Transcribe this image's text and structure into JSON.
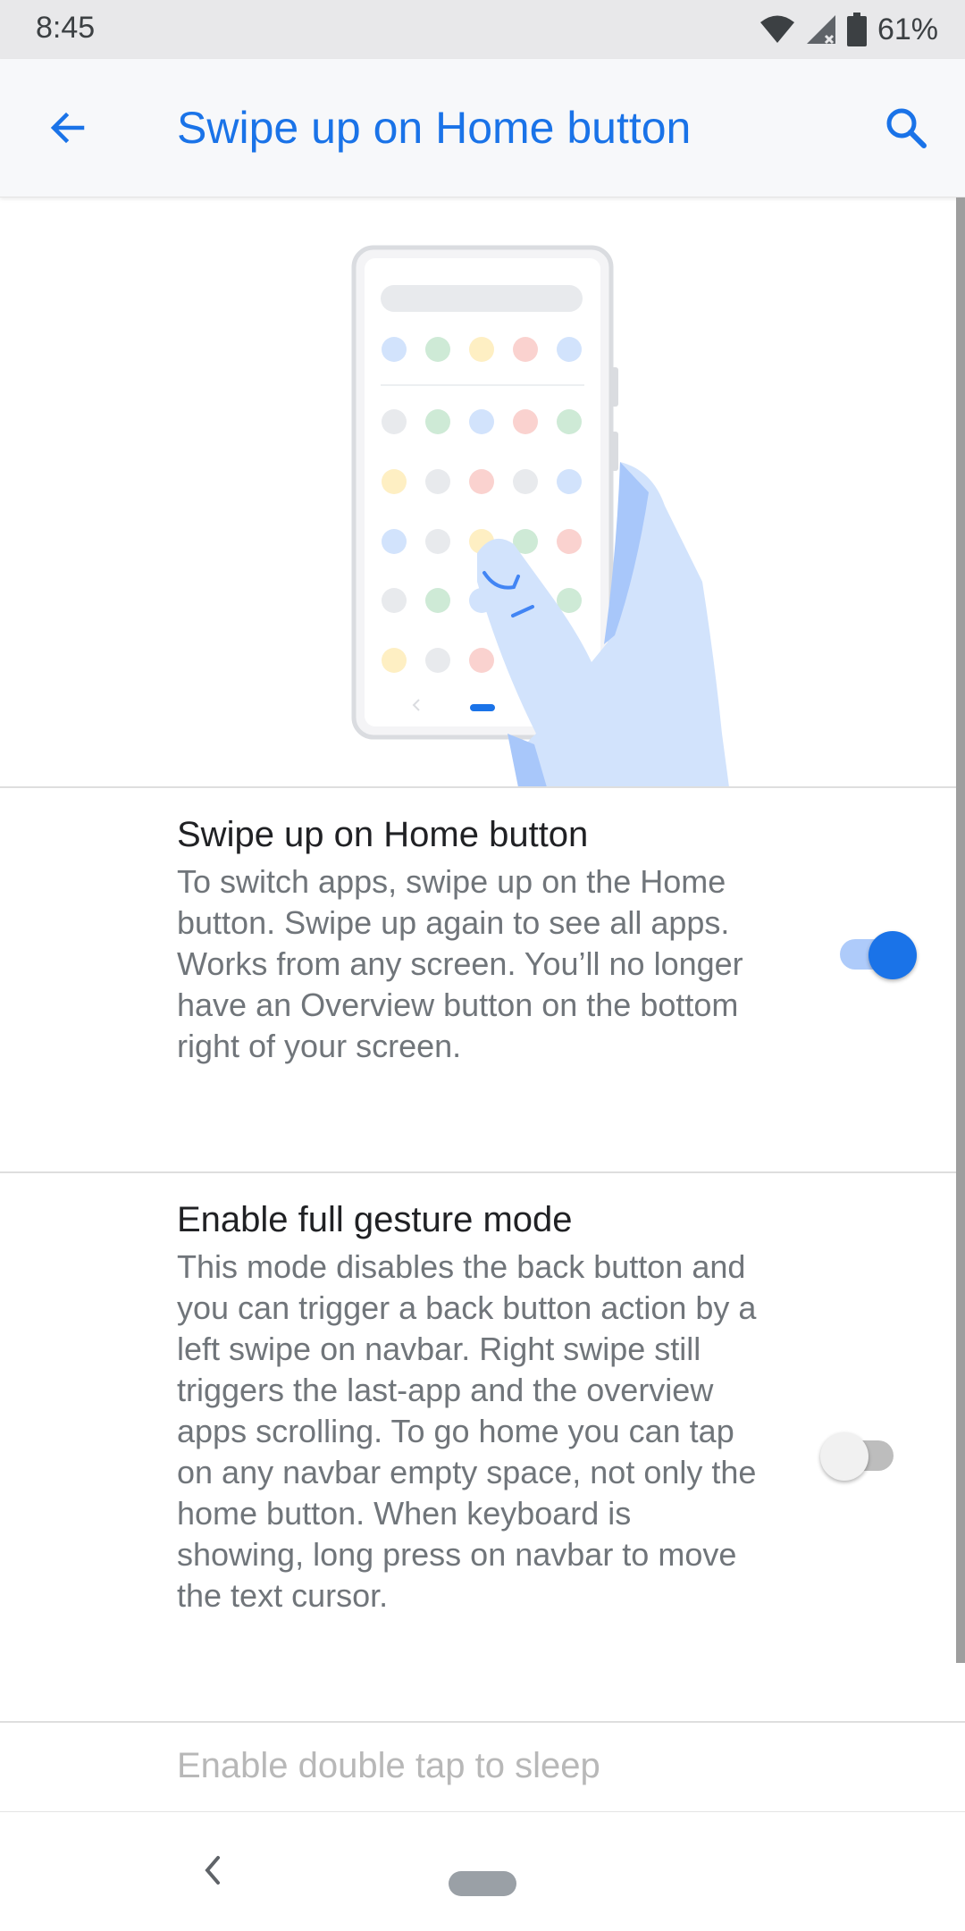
{
  "status_bar": {
    "time": "8:45",
    "battery": "61%",
    "icons": [
      "wifi-icon",
      "signal-icon",
      "battery-icon"
    ]
  },
  "app_bar": {
    "title": "Swipe up on Home button",
    "back_icon": "arrow-back-icon",
    "search_icon": "search-icon"
  },
  "settings": [
    {
      "title": "Swipe up on Home button",
      "description": "To switch apps, swipe up on the Home button. Swipe up again to see all apps. Works from any screen. You’ll no longer have an Overview button on the bottom right of your screen.",
      "enabled": true
    },
    {
      "title": "Enable full gesture mode",
      "description": "This mode disables the back button and you can trigger a back button action by a left swipe on navbar. Right swipe still triggers the last-app and the overview apps scrolling. To go home you can tap on any navbar empty space, not only the home button. When keyboard is showing, long press on navbar to move the text cursor.",
      "enabled": false
    },
    {
      "title": "Enable double tap to sleep"
    }
  ],
  "colors": {
    "accent": "#1a73e8",
    "accent_light": "#aecbfa",
    "hand": "#d2e3fc"
  }
}
